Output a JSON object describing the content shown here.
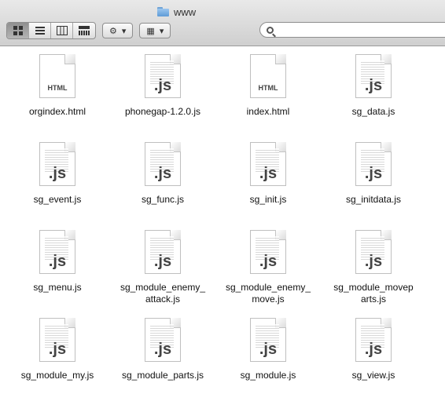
{
  "window": {
    "title": "www"
  },
  "toolbar": {
    "view_buttons": [
      "icon-view",
      "list-view",
      "column-view",
      "coverflow-view"
    ],
    "action_label": "⚙",
    "arrange_label": "▦"
  },
  "search": {
    "placeholder": "",
    "value": ""
  },
  "files": [
    {
      "name": "orgindex.html",
      "ext": "HTML",
      "type": "html"
    },
    {
      "name": "phonegap-1.2.0.js",
      "ext": ".js",
      "type": "js"
    },
    {
      "name": "index.html",
      "ext": "HTML",
      "type": "html"
    },
    {
      "name": "sg_data.js",
      "ext": ".js",
      "type": "js"
    },
    {
      "name": "sg_event.js",
      "ext": ".js",
      "type": "js"
    },
    {
      "name": "sg_func.js",
      "ext": ".js",
      "type": "js"
    },
    {
      "name": "sg_init.js",
      "ext": ".js",
      "type": "js"
    },
    {
      "name": "sg_initdata.js",
      "ext": ".js",
      "type": "js"
    },
    {
      "name": "sg_menu.js",
      "ext": ".js",
      "type": "js"
    },
    {
      "name": "sg_module_enemy_\nattack.js",
      "ext": ".js",
      "type": "js"
    },
    {
      "name": "sg_module_enemy_\nmove.js",
      "ext": ".js",
      "type": "js"
    },
    {
      "name": "sg_module_movep\narts.js",
      "ext": ".js",
      "type": "js"
    },
    {
      "name": "sg_module_my.js",
      "ext": ".js",
      "type": "js"
    },
    {
      "name": "sg_module_parts.js",
      "ext": ".js",
      "type": "js"
    },
    {
      "name": "sg_module.js",
      "ext": ".js",
      "type": "js"
    },
    {
      "name": "sg_view.js",
      "ext": ".js",
      "type": "js"
    }
  ]
}
